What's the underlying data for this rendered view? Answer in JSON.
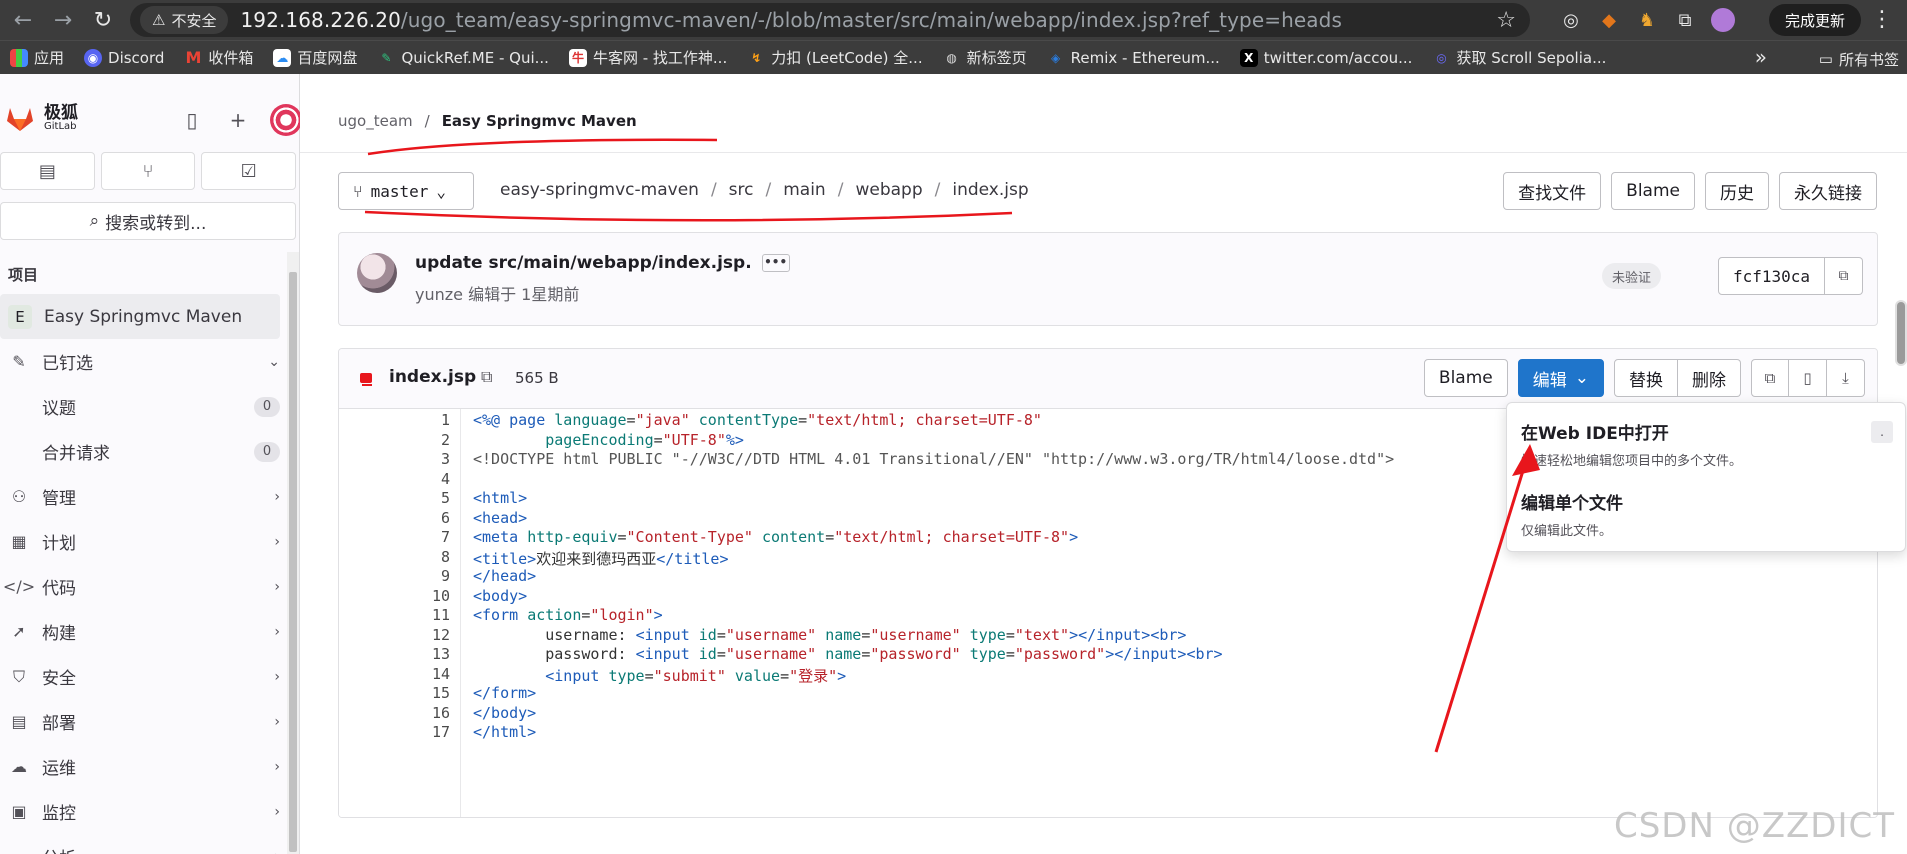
{
  "browser": {
    "insecure_label": "不安全",
    "url_host": "192.168.226.20",
    "url_path": "/ugo_team/easy-springmvc-maven/-/blob/master/src/main/webapp/index.jsp?ref_type=heads",
    "update_label": "完成更新",
    "bookmarks": [
      "应用",
      "Discord",
      "收件箱",
      "百度网盘",
      "QuickRef.ME - Qui...",
      "牛客网 - 找工作神...",
      "力扣 (LeetCode) 全...",
      "新标签页",
      "Remix - Ethereum...",
      "twitter.com/accou...",
      "获取 Scroll Sepolia..."
    ],
    "all_bookmarks": "所有书签"
  },
  "sidebar": {
    "brand_cn": "极狐",
    "brand_en": "GitLab",
    "search_label": "搜索或转到...",
    "section_label": "项目",
    "project_letter": "E",
    "project_name": "Easy Springmvc Maven",
    "pinned": "已钉选",
    "issues": "议题",
    "issues_count": "0",
    "merge_requests": "合并请求",
    "mr_count": "0",
    "items": [
      "管理",
      "计划",
      "代码",
      "构建",
      "安全",
      "部署",
      "运维",
      "监控",
      "分析"
    ]
  },
  "breadcrumb": {
    "group": "ugo_team",
    "project": "Easy Springmvc Maven"
  },
  "repo": {
    "branch": "master",
    "path": [
      "easy-springmvc-maven",
      "src",
      "main",
      "webapp",
      "index.jsp"
    ],
    "actions": [
      "查找文件",
      "Blame",
      "历史",
      "永久链接"
    ]
  },
  "commit": {
    "message": "update src/main/webapp/index.jsp.",
    "author_meta": "yunze 编辑于 1星期前",
    "badge": "未验证",
    "sha": "fcf130ca"
  },
  "file": {
    "name": "index.jsp",
    "size": "565 B",
    "blame": "Blame",
    "edit": "编辑",
    "replace": "替换",
    "delete": "删除"
  },
  "code_lines": [
    "1",
    "2",
    "3",
    "4",
    "5",
    "6",
    "7",
    "8",
    "9",
    "10",
    "11",
    "12",
    "13",
    "14",
    "15",
    "16",
    "17"
  ],
  "dropdown": {
    "item1_title": "在Web IDE中打开",
    "item1_desc": "快速轻松地编辑您项目中的多个文件。",
    "item2_title": "编辑单个文件",
    "item2_desc": "仅编辑此文件。"
  },
  "watermark": "CSDN @ZZDICT",
  "colors": {
    "primary": "#1f75cb",
    "annotation": "#e8161c",
    "chrome": "#3c3c3c"
  }
}
